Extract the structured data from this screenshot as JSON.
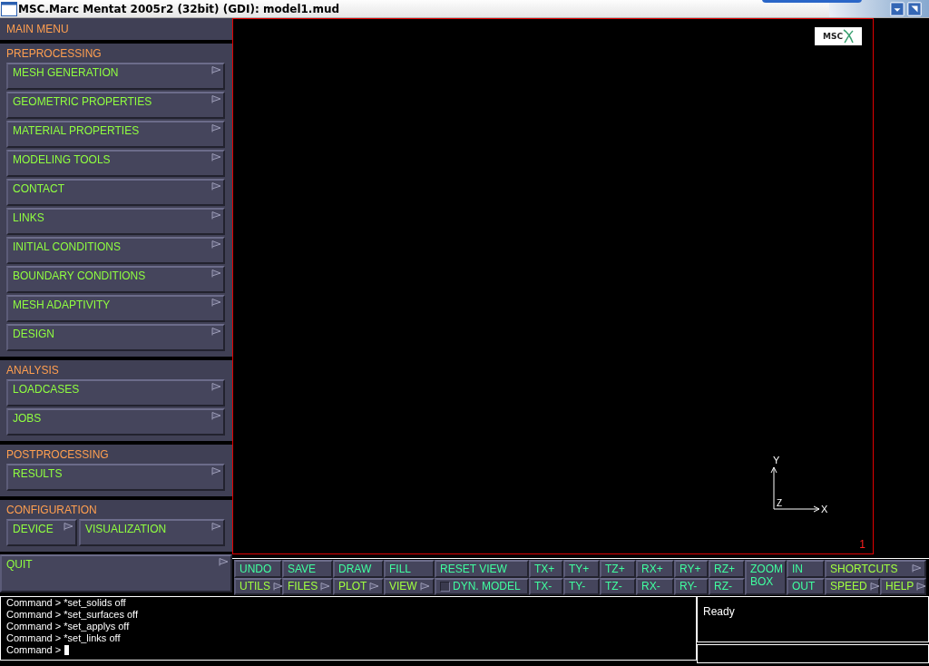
{
  "window": {
    "title": "MSC.Marc Mentat 2005r2 (32bit) (GDI): model1.mud"
  },
  "sidebar": {
    "header": "MAIN MENU",
    "sections": [
      {
        "title": "PREPROCESSING",
        "kind": "stack",
        "items": [
          {
            "label": "MESH GENERATION"
          },
          {
            "label": "GEOMETRIC PROPERTIES"
          },
          {
            "label": "MATERIAL PROPERTIES"
          },
          {
            "label": "MODELING TOOLS"
          },
          {
            "label": "CONTACT"
          },
          {
            "label": "LINKS"
          },
          {
            "label": "INITIAL CONDITIONS"
          },
          {
            "label": "BOUNDARY CONDITIONS"
          },
          {
            "label": "MESH ADAPTIVITY"
          },
          {
            "label": "DESIGN"
          }
        ]
      },
      {
        "title": "ANALYSIS",
        "kind": "stack",
        "items": [
          {
            "label": "LOADCASES"
          },
          {
            "label": "JOBS"
          }
        ]
      },
      {
        "title": "POSTPROCESSING",
        "kind": "stack",
        "items": [
          {
            "label": "RESULTS"
          }
        ]
      },
      {
        "title": "CONFIGURATION",
        "kind": "row",
        "items": [
          {
            "label": "DEVICE"
          },
          {
            "label": "VISUALIZATION"
          }
        ]
      }
    ],
    "quit": {
      "label": "QUIT"
    }
  },
  "viewport": {
    "logo_text": "MSC",
    "axes": {
      "y_label": "Y",
      "x_label": "X",
      "z_label": "Z"
    },
    "viewport_number": "1"
  },
  "toolbar": {
    "columns": [
      [
        [
          {
            "label": "UNDO",
            "kind": "action"
          }
        ],
        [
          {
            "label": "UTILS",
            "kind": "menu"
          }
        ]
      ],
      [
        [
          {
            "label": "SAVE",
            "kind": "action"
          }
        ],
        [
          {
            "label": "FILES",
            "kind": "menu"
          }
        ]
      ],
      [
        [
          {
            "label": "DRAW",
            "kind": "action"
          }
        ],
        [
          {
            "label": "PLOT",
            "kind": "menu"
          }
        ]
      ],
      [
        [
          {
            "label": "FILL",
            "kind": "action"
          }
        ],
        [
          {
            "label": "VIEW",
            "kind": "menu"
          }
        ]
      ],
      [
        [
          {
            "label": "RESET VIEW",
            "kind": "action"
          }
        ],
        [
          {
            "label": "DYN. MODEL",
            "kind": "toggle",
            "checked": false
          }
        ]
      ],
      [
        [
          {
            "label": "TX+",
            "kind": "action"
          }
        ],
        [
          {
            "label": "TX-",
            "kind": "action"
          }
        ]
      ],
      [
        [
          {
            "label": "TY+",
            "kind": "action"
          }
        ],
        [
          {
            "label": "TY-",
            "kind": "action"
          }
        ]
      ],
      [
        [
          {
            "label": "TZ+",
            "kind": "action"
          }
        ],
        [
          {
            "label": "TZ-",
            "kind": "action"
          }
        ]
      ],
      [
        [
          {
            "label": "RX+",
            "kind": "action"
          }
        ],
        [
          {
            "label": "RX-",
            "kind": "action"
          }
        ]
      ],
      [
        [
          {
            "label": "RY+",
            "kind": "action"
          }
        ],
        [
          {
            "label": "RY-",
            "kind": "action"
          }
        ]
      ],
      [
        [
          {
            "label": "RZ+",
            "kind": "action"
          }
        ],
        [
          {
            "label": "RZ-",
            "kind": "action"
          }
        ]
      ],
      [
        [
          {
            "label": "ZOOM BOX",
            "kind": "action"
          }
        ]
      ],
      [
        [
          {
            "label": "IN",
            "kind": "action"
          }
        ],
        [
          {
            "label": "OUT",
            "kind": "action"
          }
        ]
      ],
      [
        [
          {
            "label": "SHORTCUTS",
            "kind": "menu"
          }
        ],
        [
          {
            "label": "SPEED",
            "kind": "menu"
          },
          {
            "label": "HELP",
            "kind": "menu"
          }
        ]
      ]
    ]
  },
  "command_log": {
    "lines": [
      {
        "prompt": "Command >",
        "command": "*set_solids off"
      },
      {
        "prompt": "Command >",
        "command": "*set_surfaces off"
      },
      {
        "prompt": "Command >",
        "command": "*set_applys off"
      },
      {
        "prompt": "Command >",
        "command": "*set_links off"
      }
    ],
    "input_prompt": "Command >"
  },
  "status": {
    "message": "Ready"
  }
}
